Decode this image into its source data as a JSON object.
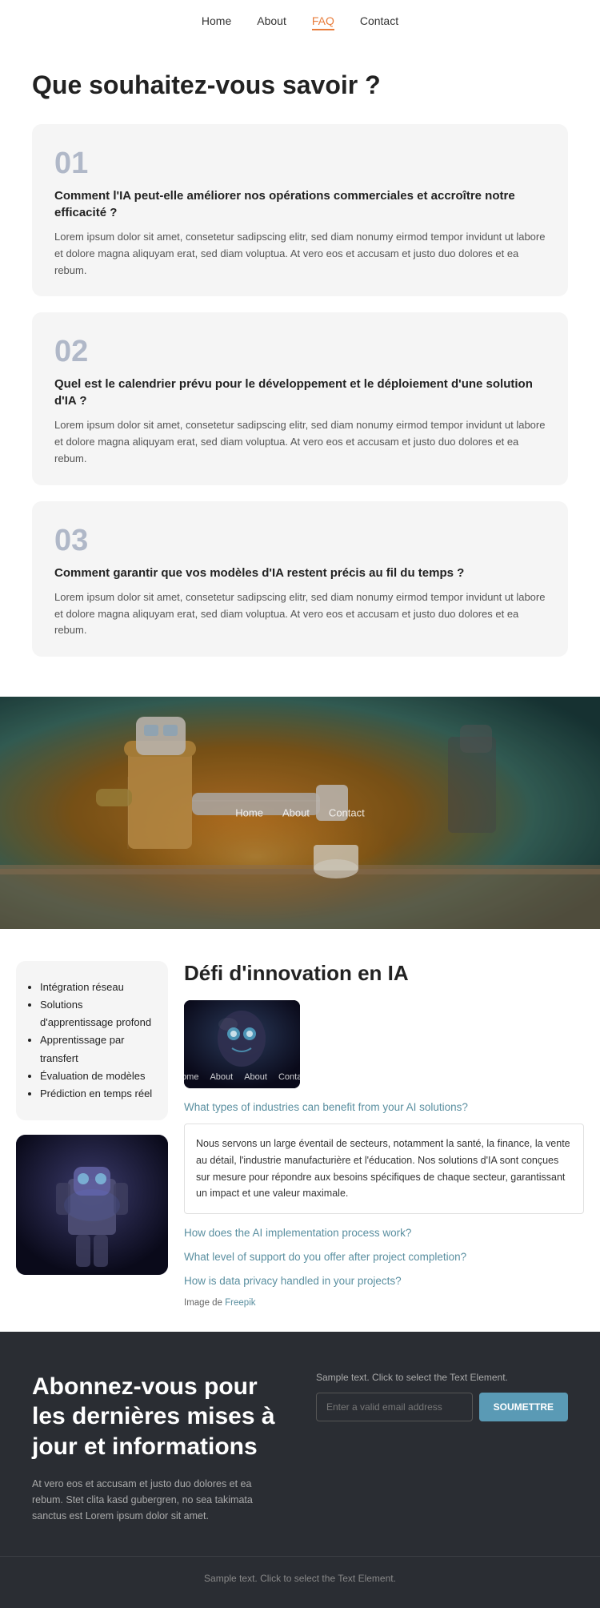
{
  "nav": {
    "items": [
      {
        "label": "Home",
        "active": false
      },
      {
        "label": "About",
        "active": false
      },
      {
        "label": "FAQ",
        "active": true
      },
      {
        "label": "Contact",
        "active": false
      }
    ]
  },
  "faq": {
    "title": "Que souhaitez-vous savoir ?",
    "items": [
      {
        "num": "01",
        "question": "Comment l'IA peut-elle améliorer nos opérations commerciales et accroître notre efficacité ?",
        "answer": "Lorem ipsum dolor sit amet, consetetur sadipscing elitr, sed diam nonumy eirmod tempor invidunt ut labore et dolore magna aliquyam erat, sed diam voluptua. At vero eos et accusam et justo duo dolores et ea rebum."
      },
      {
        "num": "02",
        "question": "Quel est le calendrier prévu pour le développement et le déploiement d'une solution d'IA ?",
        "answer": "Lorem ipsum dolor sit amet, consetetur sadipscing elitr, sed diam nonumy eirmod tempor invidunt ut labore et dolore magna aliquyam erat, sed diam voluptua. At vero eos et accusam et justo duo dolores et ea rebum."
      },
      {
        "num": "03",
        "question": "Comment garantir que vos modèles d'IA restent précis au fil du temps ?",
        "answer": "Lorem ipsum dolor sit amet, consetetur sadipscing elitr, sed diam nonumy eirmod tempor invidunt ut labore et dolore magna aliquyam erat, sed diam voluptua. At vero eos et accusam et justo duo dolores et ea rebum."
      }
    ]
  },
  "banner_nav": [
    "Home",
    "About",
    "Contact"
  ],
  "innovation": {
    "title": "Défi d'innovation en IA",
    "list_items": [
      "Intégration réseau",
      "Solutions d'apprentissage profond",
      "Apprentissage par transfert",
      "Évaluation de modèles",
      "Prédiction en temps réel"
    ],
    "face_nav": [
      "Home",
      "About",
      "About",
      "Contact"
    ],
    "faq_links": [
      "What types of industries can benefit from your AI solutions?",
      "How does the AI implementation process work?",
      "What level of support do you offer after project completion?",
      "How is data privacy handled in your projects?"
    ],
    "expanded_answer": "Nous servons un large éventail de secteurs, notamment la santé, la finance, la vente au détail, l'industrie manufacturière et l'éducation. Nos solutions d'IA sont conçues sur mesure pour répondre aux besoins spécifiques de chaque secteur, garantissant un impact et une valeur maximale.",
    "image_credit_text": "Image de",
    "image_credit_link": "Freepik"
  },
  "subscribe": {
    "title": "Abonnez-vous pour les dernières mises à jour et informations",
    "description": "At vero eos et accusam et justo duo dolores et ea rebum. Stet clita kasd gubergren, no sea takimata sanctus est Lorem ipsum dolor sit amet.",
    "sample_text": "Sample text. Click to select the Text Element.",
    "input_placeholder": "Enter a valid email address",
    "button_label": "SOUMETTRE"
  },
  "footer": {
    "text": "Sample text. Click to select the Text Element."
  }
}
